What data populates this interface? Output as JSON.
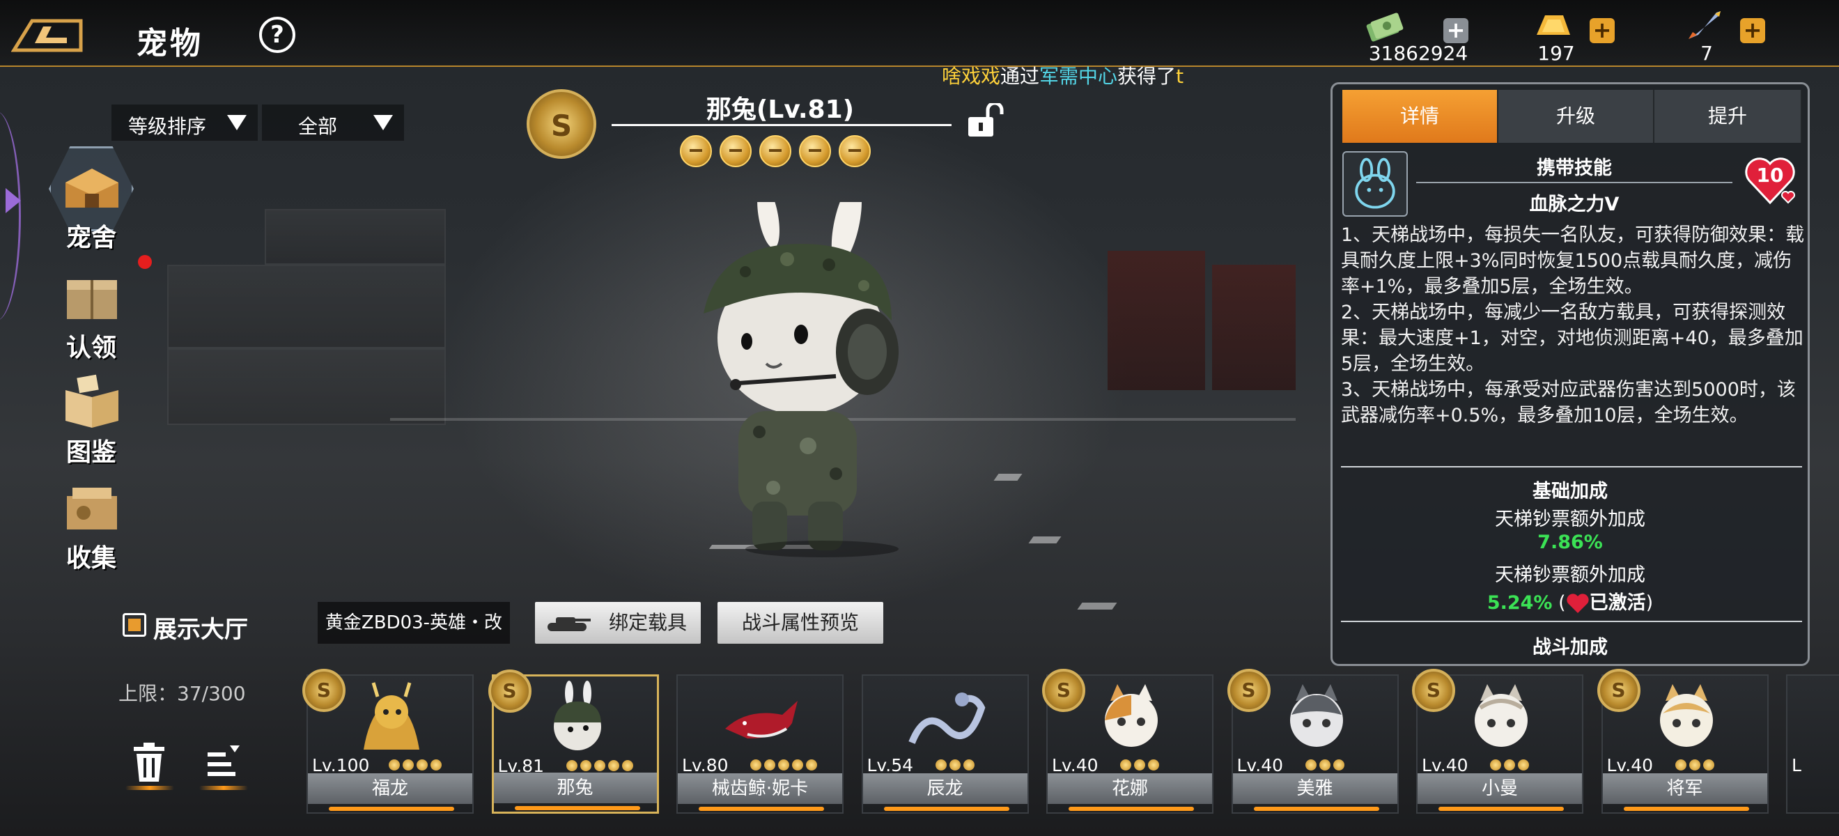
{
  "header": {
    "title": "宠物",
    "help_label": "?"
  },
  "currencies": [
    {
      "name": "banknotes-icon",
      "value": "31862924",
      "plus": "+"
    },
    {
      "name": "gold-bars-icon",
      "value": "197",
      "plus": "+"
    },
    {
      "name": "rocket-icon",
      "value": "7",
      "plus": "+"
    }
  ],
  "ticker": {
    "part1": "啥戏戏",
    "part2": "通过",
    "part3": "军需中心",
    "part4": "获得了",
    "part5": "t"
  },
  "filters": {
    "sort_label": "等级排序",
    "filter_label": "全部"
  },
  "side_nav": [
    {
      "label": "宠舍",
      "icon": "kennel-icon"
    },
    {
      "label": "认领",
      "icon": "crate-icon"
    },
    {
      "label": "图鉴",
      "icon": "book-icon"
    },
    {
      "label": "收集",
      "icon": "collection-icon"
    }
  ],
  "show_hall_label": "展示大厅",
  "capacity": "上限：37/300",
  "pet": {
    "name": "那兔(Lv.81)",
    "badge": "S",
    "bells": 5
  },
  "vehicle": {
    "name": "黄金ZBD03-英雄・改",
    "bind_label": "绑定载具",
    "preview_label": "战斗属性预览"
  },
  "panel": {
    "tabs": [
      "详情",
      "升级",
      "提升"
    ],
    "active_tab": 0,
    "skill_header": "携带技能",
    "skill_name": "血脉之力V",
    "heart_value": "10",
    "desc": [
      "1、天梯战场中，每损失一名队友，可获得防御效果：载具耐久度上限+3%同时恢复1500点载具耐久度，减伤率+1%，最多叠加5层，全场生效。",
      "2、天梯战场中，每减少一名敌方载具，可获得探测效果：最大速度+1，对空，对地侦测距离+40，最多叠加5层，全场生效。",
      "3、天梯战场中，每承受对应武器伤害达到5000时，该武器减伤率+0.5%，最多叠加10层，全场生效。"
    ],
    "base_title": "基础加成",
    "base_row1_label": "天梯钞票额外加成",
    "base_row1_value": "7.86%",
    "base_row2_label": "天梯钞票额外加成",
    "base_row2_value": "5.24%",
    "base_row2_paren_open": "(",
    "base_row2_status": "已激活",
    "base_row2_paren_close": ")",
    "combat_title": "战斗加成"
  },
  "cards": [
    {
      "name": "福龙",
      "level": "Lv.100",
      "stars": 4,
      "badge": true,
      "art": "dragon"
    },
    {
      "name": "那兔",
      "level": "Lv.81",
      "stars": 5,
      "badge": true,
      "art": "rabbit",
      "selected": true
    },
    {
      "name": "械齿鲸·妮卡",
      "level": "Lv.80",
      "stars": 5,
      "badge": false,
      "art": "whale"
    },
    {
      "name": "辰龙",
      "level": "Lv.54",
      "stars": 3,
      "badge": false,
      "art": "serpent"
    },
    {
      "name": "花娜",
      "level": "Lv.40",
      "stars": 3,
      "badge": true,
      "art": "cat-orange"
    },
    {
      "name": "美雅",
      "level": "Lv.40",
      "stars": 3,
      "badge": true,
      "art": "cat-grey"
    },
    {
      "name": "小曼",
      "level": "Lv.40",
      "stars": 3,
      "badge": true,
      "art": "cat-white"
    },
    {
      "name": "将军",
      "level": "Lv.40",
      "stars": 3,
      "badge": true,
      "art": "cat-yellow"
    }
  ],
  "colors": {
    "accent": "#e0791b",
    "gold": "#d8b45a",
    "green": "#3be255"
  }
}
